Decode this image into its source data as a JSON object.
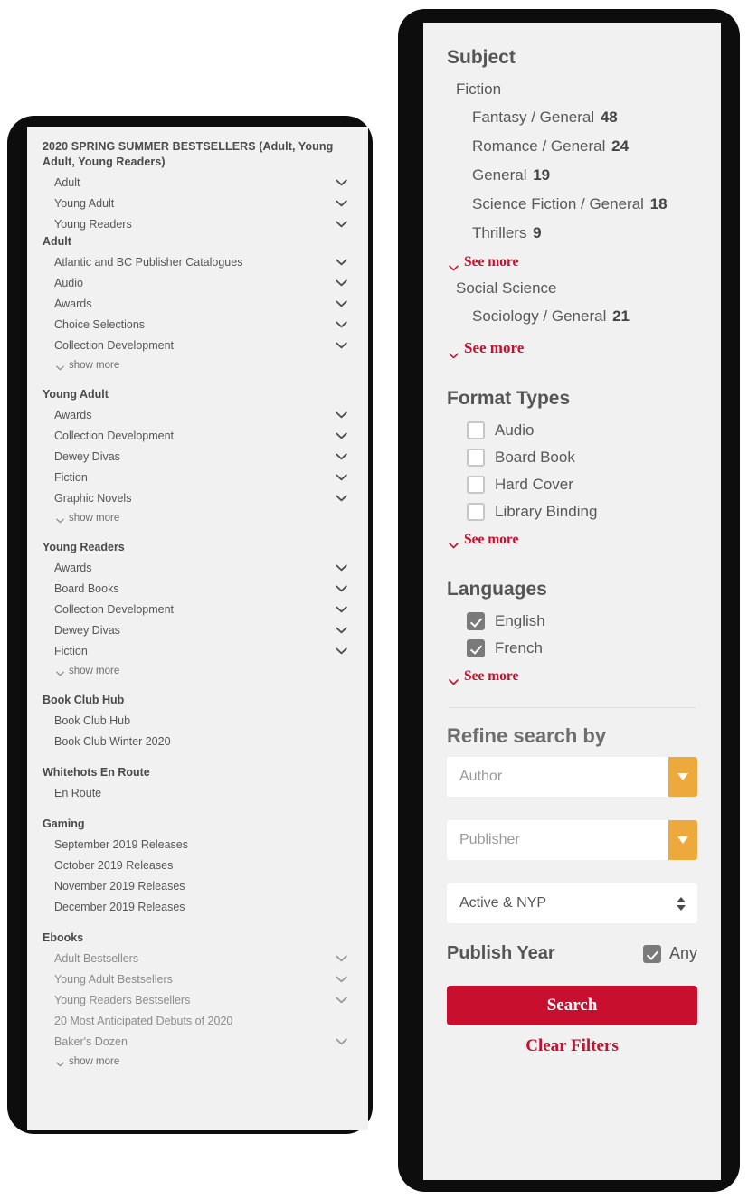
{
  "colors": {
    "accent_red": "#c8102e",
    "accent_orange": "#eda93b",
    "panel_bg": "#f1f1f1",
    "frame": "#0d0d0d",
    "text_gray": "#555555",
    "text_dim": "#8b8b8b"
  },
  "left_panel": {
    "catalogue_title": "2020 SPRING SUMMER BESTSELLERS (Adult, Young Adult, Young Readers)",
    "top_items": [
      {
        "label": "Adult",
        "chevron": true
      },
      {
        "label": "Young Adult",
        "chevron": true
      },
      {
        "label": "Young Readers",
        "chevron": true
      }
    ],
    "groups": [
      {
        "heading": "Adult",
        "dim": false,
        "items": [
          {
            "label": "Atlantic and BC Publisher Catalogues",
            "chevron": true
          },
          {
            "label": "Audio",
            "chevron": true
          },
          {
            "label": "Awards",
            "chevron": true
          },
          {
            "label": "Choice Selections",
            "chevron": true
          },
          {
            "label": "Collection Development",
            "chevron": true
          }
        ],
        "show_more": "show more"
      },
      {
        "heading": "Young Adult",
        "dim": false,
        "items": [
          {
            "label": "Awards",
            "chevron": true
          },
          {
            "label": "Collection Development",
            "chevron": true
          },
          {
            "label": "Dewey Divas",
            "chevron": true
          },
          {
            "label": "Fiction",
            "chevron": true
          },
          {
            "label": "Graphic Novels",
            "chevron": true
          }
        ],
        "show_more": "show more"
      },
      {
        "heading": "Young Readers",
        "dim": false,
        "items": [
          {
            "label": "Awards",
            "chevron": true
          },
          {
            "label": "Board Books",
            "chevron": true
          },
          {
            "label": "Collection Development",
            "chevron": true
          },
          {
            "label": "Dewey Divas",
            "chevron": true
          },
          {
            "label": "Fiction",
            "chevron": true
          }
        ],
        "show_more": "show more"
      },
      {
        "heading": "Book Club Hub",
        "dim": false,
        "items": [
          {
            "label": "Book Club Hub",
            "chevron": false
          },
          {
            "label": "Book Club Winter 2020",
            "chevron": false
          }
        ],
        "show_more": null
      },
      {
        "heading": "Whitehots En Route",
        "dim": false,
        "items": [
          {
            "label": "En Route",
            "chevron": false
          }
        ],
        "show_more": null
      },
      {
        "heading": "Gaming",
        "dim": false,
        "items": [
          {
            "label": "September 2019 Releases",
            "chevron": false
          },
          {
            "label": "October 2019 Releases",
            "chevron": false
          },
          {
            "label": "November 2019 Releases",
            "chevron": false
          },
          {
            "label": "December 2019 Releases",
            "chevron": false
          }
        ],
        "show_more": null
      },
      {
        "heading": "Ebooks",
        "dim": true,
        "items": [
          {
            "label": "Adult Bestsellers",
            "chevron": true
          },
          {
            "label": "Young Adult Bestsellers",
            "chevron": true
          },
          {
            "label": "Young Readers Bestsellers",
            "chevron": true
          },
          {
            "label": "20 Most Anticipated Debuts of 2020",
            "chevron": false
          },
          {
            "label": "Baker's Dozen",
            "chevron": true
          }
        ],
        "show_more": "show more"
      }
    ]
  },
  "right_panel": {
    "subject": {
      "title": "Subject",
      "categories": [
        {
          "name": "Fiction",
          "children": [
            {
              "label": "Fantasy / General",
              "count": "48"
            },
            {
              "label": "Romance / General",
              "count": "24"
            },
            {
              "label": "General",
              "count": "19"
            },
            {
              "label": "Science Fiction / General",
              "count": "18"
            },
            {
              "label": "Thrillers",
              "count": "9"
            }
          ],
          "see_more": "See more"
        },
        {
          "name": "Social Science",
          "children": [
            {
              "label": "Sociology / General",
              "count": "21"
            }
          ],
          "see_more": "See more"
        }
      ]
    },
    "format_types": {
      "title": "Format Types",
      "options": [
        {
          "label": "Audio",
          "checked": false
        },
        {
          "label": "Board Book",
          "checked": false
        },
        {
          "label": "Hard Cover",
          "checked": false
        },
        {
          "label": "Library Binding",
          "checked": false
        }
      ],
      "see_more": "See more"
    },
    "languages": {
      "title": "Languages",
      "options": [
        {
          "label": "English",
          "checked": true
        },
        {
          "label": "French",
          "checked": true
        }
      ],
      "see_more": "See more"
    },
    "refine": {
      "title": "Refine search by",
      "author_placeholder": "Author",
      "publisher_placeholder": "Publisher",
      "status_value": "Active & NYP",
      "publish_year_label": "Publish Year",
      "publish_year_any_label": "Any",
      "publish_year_any_checked": true,
      "search_label": "Search",
      "clear_label": "Clear Filters"
    }
  }
}
